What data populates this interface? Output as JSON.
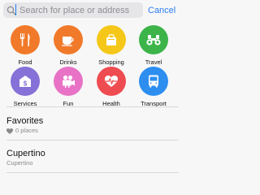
{
  "search": {
    "placeholder": "Search for place or address",
    "value": "",
    "cancel_label": "Cancel"
  },
  "categories": [
    {
      "label": "Food",
      "icon": "fork-knife-icon",
      "color": "#f17a2a"
    },
    {
      "label": "Drinks",
      "icon": "coffee-cup-icon",
      "color": "#f17a2a"
    },
    {
      "label": "Shopping",
      "icon": "shopping-bag-icon",
      "color": "#f5c718"
    },
    {
      "label": "Travel",
      "icon": "binoculars-icon",
      "color": "#3cb44a"
    },
    {
      "label": "Services",
      "icon": "building-dollar-icon",
      "color": "#8571d8"
    },
    {
      "label": "Fun",
      "icon": "movie-camera-icon",
      "color": "#e873c6"
    },
    {
      "label": "Health",
      "icon": "heart-pulse-icon",
      "color": "#ee4c51"
    },
    {
      "label": "Transport",
      "icon": "bus-icon",
      "color": "#2d8ef0"
    }
  ],
  "favorites": {
    "title": "Favorites",
    "subtitle": "0 places",
    "icon": "heart-icon"
  },
  "recent": {
    "title": "Cupertino",
    "subtitle": "Cupertino"
  }
}
